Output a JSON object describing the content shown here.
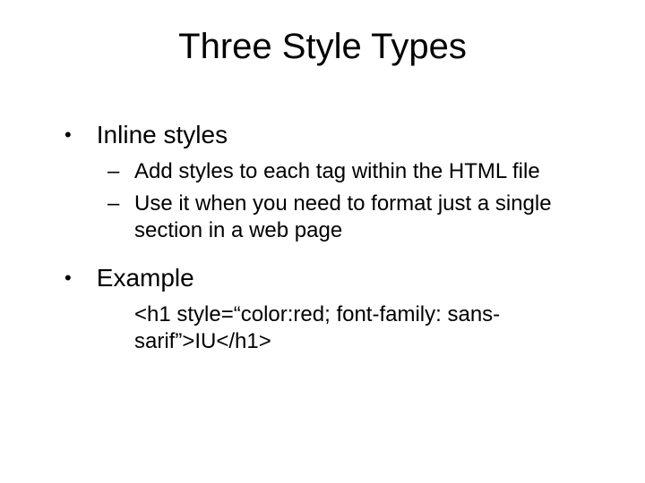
{
  "title": "Three Style Types",
  "items": [
    {
      "label": "Inline styles",
      "sub": [
        "Add styles to each tag within the HTML file",
        "Use it when you need to format just a single section in a web page"
      ]
    },
    {
      "label": "Example",
      "code": "<h1 style=“color:red; font-family: sans-sarif”>IU</h1>"
    }
  ]
}
